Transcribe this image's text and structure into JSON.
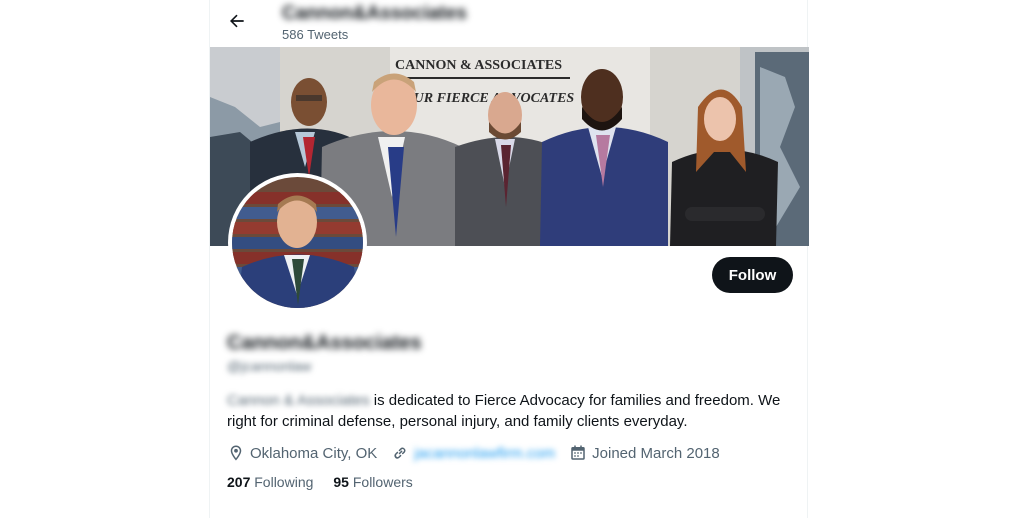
{
  "header": {
    "name": "Cannon&Associates",
    "tweet_count": "586 Tweets"
  },
  "banner": {
    "sign_line1": "CANNON & ASSOCIATES",
    "sign_line2": "YOUR FIERCE ADVOCATES"
  },
  "profile": {
    "name": "Cannon&Associates",
    "handle": "@jcannonlaw",
    "follow_label": "Follow",
    "bio_mention": "Cannon & Associates",
    "bio_text": " is dedicated to Fierce Advocacy for families and freedom. We right for criminal defense, personal injury, and family clients everyday.",
    "location": "Oklahoma City, OK",
    "website": "jacannonlawfirm.com",
    "joined": "Joined March 2018",
    "following_count": "207",
    "following_label": " Following",
    "followers_count": "95",
    "followers_label": " Followers"
  },
  "colors": {
    "text": "#0f1419",
    "secondary": "#536471",
    "link": "#1d9bf0",
    "button": "#0f1419"
  },
  "icons": {
    "back": "arrow-left-icon",
    "location": "location-pin-icon",
    "website": "link-icon",
    "joined": "calendar-icon"
  }
}
